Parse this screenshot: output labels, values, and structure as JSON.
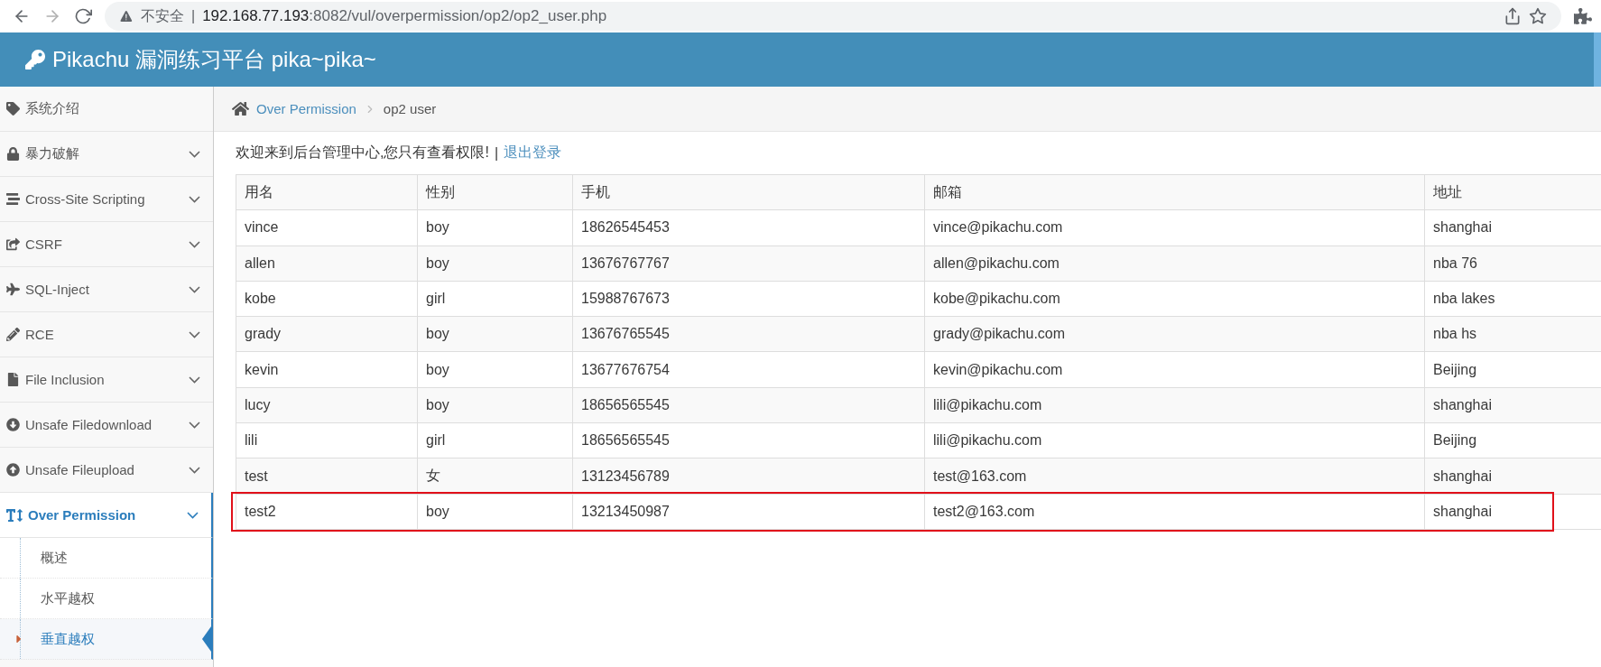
{
  "browser": {
    "security_label": "不安全",
    "separator": "|",
    "url_host": "192.168.77.193",
    "url_rest": ":8082/vul/overpermission/op2/op2_user.php"
  },
  "header": {
    "title": "Pikachu 漏洞练习平台 pika~pika~"
  },
  "sidebar": {
    "items": [
      {
        "label": "系统介绍",
        "selected": false,
        "expandable": false
      },
      {
        "label": "暴力破解",
        "selected": false,
        "expandable": true
      },
      {
        "label": "Cross-Site Scripting",
        "selected": false,
        "expandable": true
      },
      {
        "label": "CSRF",
        "selected": false,
        "expandable": true
      },
      {
        "label": "SQL-Inject",
        "selected": false,
        "expandable": true
      },
      {
        "label": "RCE",
        "selected": false,
        "expandable": true
      },
      {
        "label": "File Inclusion",
        "selected": false,
        "expandable": true
      },
      {
        "label": "Unsafe Filedownload",
        "selected": false,
        "expandable": true
      },
      {
        "label": "Unsafe Fileupload",
        "selected": false,
        "expandable": true
      },
      {
        "label": "Over Permission",
        "selected": true,
        "expandable": true,
        "children": [
          {
            "label": "概述",
            "selected": false
          },
          {
            "label": "水平越权",
            "selected": false
          },
          {
            "label": "垂直越权",
            "selected": true
          }
        ]
      }
    ]
  },
  "breadcrumb": {
    "link": "Over Permission",
    "current": "op2 user"
  },
  "welcome": {
    "text": "欢迎来到后台管理中心,您只有查看权限!",
    "separator": "|",
    "logout": "退出登录"
  },
  "table": {
    "columns": [
      "用名",
      "性别",
      "手机",
      "邮箱",
      "地址"
    ],
    "rows": [
      {
        "cells": [
          "vince",
          "boy",
          "18626545453",
          "vince@pikachu.com",
          "shanghai"
        ],
        "highlighted": false
      },
      {
        "cells": [
          "allen",
          "boy",
          "13676767767",
          "allen@pikachu.com",
          "nba 76"
        ],
        "highlighted": false
      },
      {
        "cells": [
          "kobe",
          "girl",
          "15988767673",
          "kobe@pikachu.com",
          "nba lakes"
        ],
        "highlighted": false
      },
      {
        "cells": [
          "grady",
          "boy",
          "13676765545",
          "grady@pikachu.com",
          "nba hs"
        ],
        "highlighted": false
      },
      {
        "cells": [
          "kevin",
          "boy",
          "13677676754",
          "kevin@pikachu.com",
          "Beijing"
        ],
        "highlighted": false
      },
      {
        "cells": [
          "lucy",
          "boy",
          "18656565545",
          "lili@pikachu.com",
          "shanghai"
        ],
        "highlighted": false
      },
      {
        "cells": [
          "lili",
          "girl",
          "18656565545",
          "lili@pikachu.com",
          "Beijing"
        ],
        "highlighted": false
      },
      {
        "cells": [
          "test",
          "女",
          "13123456789",
          "test@163.com",
          "shanghai"
        ],
        "highlighted": false
      },
      {
        "cells": [
          "test2",
          "boy",
          "13213450987",
          "test2@163.com",
          "shanghai"
        ],
        "highlighted": true
      }
    ]
  }
}
